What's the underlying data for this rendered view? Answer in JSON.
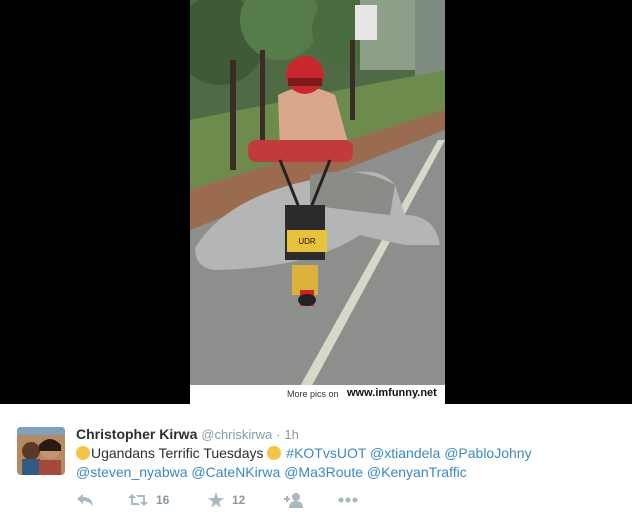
{
  "image": {
    "watermark_prefix": "More pics on",
    "watermark_site": "www.imfunny.net",
    "plate_text": "UDR"
  },
  "tweet": {
    "author_name": "Christopher Kirwa",
    "author_handle": "@chriskirwa",
    "separator": "·",
    "time": "1h",
    "text_parts": {
      "lead": "Ugandans Terrific Tuesdays",
      "hashtag": "#KOTvsUOT",
      "mention1": "@xtiandela",
      "mention2": "@PabloJohny",
      "mention3": "@steven_nyabwa",
      "mention4": "@CateNKirwa",
      "mention5": "@Ma3Route",
      "mention6": "@KenyanTraffic"
    },
    "actions": {
      "reply_icon": "reply-icon",
      "retweet_icon": "retweet-icon",
      "retweet_count": "16",
      "favorite_icon": "star-icon",
      "favorite_count": "12",
      "follow_icon": "add-user-icon",
      "more_icon": "more-icon"
    }
  }
}
